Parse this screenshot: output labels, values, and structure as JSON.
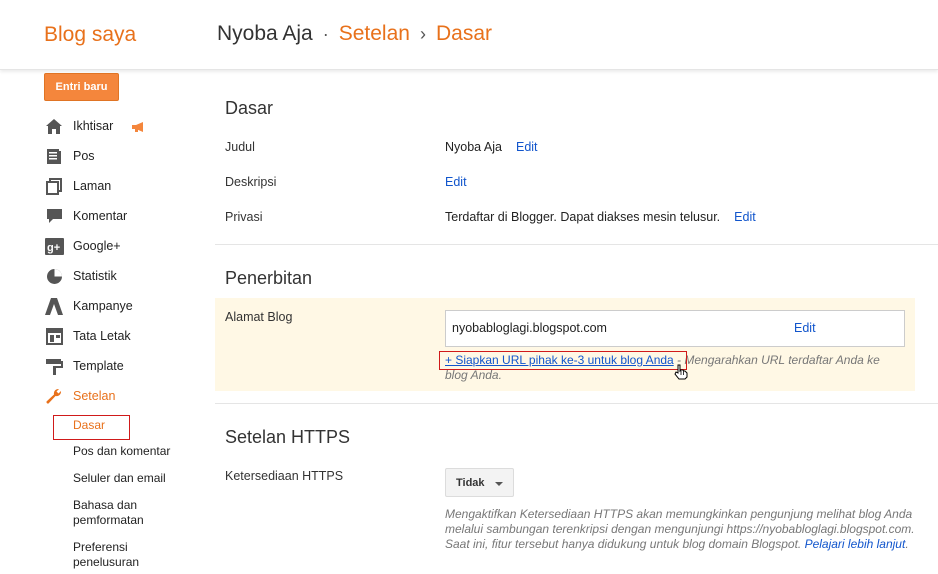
{
  "header": {
    "brand": "Blog saya",
    "blog_name": "Nyoba Aja",
    "separator_1": "·",
    "crumb_1": "Setelan",
    "separator_2": "›",
    "crumb_2": "Dasar"
  },
  "sidebar": {
    "new_post_label": "Entri baru",
    "items": [
      {
        "label": "Ikhtisar",
        "icon": "home-icon"
      },
      {
        "label": "Pos",
        "icon": "posts-icon"
      },
      {
        "label": "Laman",
        "icon": "pages-icon"
      },
      {
        "label": "Komentar",
        "icon": "comment-icon"
      },
      {
        "label": "Google+",
        "icon": "google-plus-icon"
      },
      {
        "label": "Statistik",
        "icon": "stats-icon"
      },
      {
        "label": "Kampanye",
        "icon": "campaign-icon"
      },
      {
        "label": "Tata Letak",
        "icon": "layout-icon"
      },
      {
        "label": "Template",
        "icon": "template-icon"
      },
      {
        "label": "Setelan",
        "icon": "wrench-icon"
      }
    ],
    "sub_items": [
      {
        "label": "Dasar"
      },
      {
        "label": "Pos dan komentar"
      },
      {
        "label": "Seluler dan email"
      },
      {
        "label": "Bahasa dan pemformatan"
      },
      {
        "label": "Preferensi penelusuran"
      }
    ]
  },
  "main": {
    "basic": {
      "title": "Dasar",
      "title_label": "Judul",
      "title_value": "Nyoba Aja",
      "title_edit": "Edit",
      "description_label": "Deskripsi",
      "description_edit": "Edit",
      "privacy_label": "Privasi",
      "privacy_value": "Terdaftar di Blogger. Dapat diakses mesin telusur.",
      "privacy_edit": "Edit"
    },
    "publishing": {
      "title": "Penerbitan",
      "address_label": "Alamat Blog",
      "address_value": "nyobabloglagi.blogspot.com",
      "address_edit": "Edit",
      "setup_link": "+ Siapkan URL pihak ke-3 untuk blog Anda",
      "setup_text": " - Mengarahkan URL terdaftar Anda ke blog Anda."
    },
    "https": {
      "title": "Setelan HTTPS",
      "availability_label": "Ketersediaan HTTPS",
      "availability_value": "Tidak",
      "description": "Mengaktifkan Ketersediaan HTTPS akan memungkinkan pengunjung melihat blog Anda melalui sambungan terenkripsi dengan mengunjungi https://nyobabloglagi.blogspot.com. Saat ini, fitur tersebut hanya didukung untuk blog domain Blogspot. ",
      "learn_more": "Pelajari lebih lanjut",
      "end_punct": "."
    }
  },
  "colors": {
    "accent": "#e8711b",
    "link": "#1155cc",
    "highlight": "#fff8e5",
    "annotation": "#d01a1a"
  }
}
